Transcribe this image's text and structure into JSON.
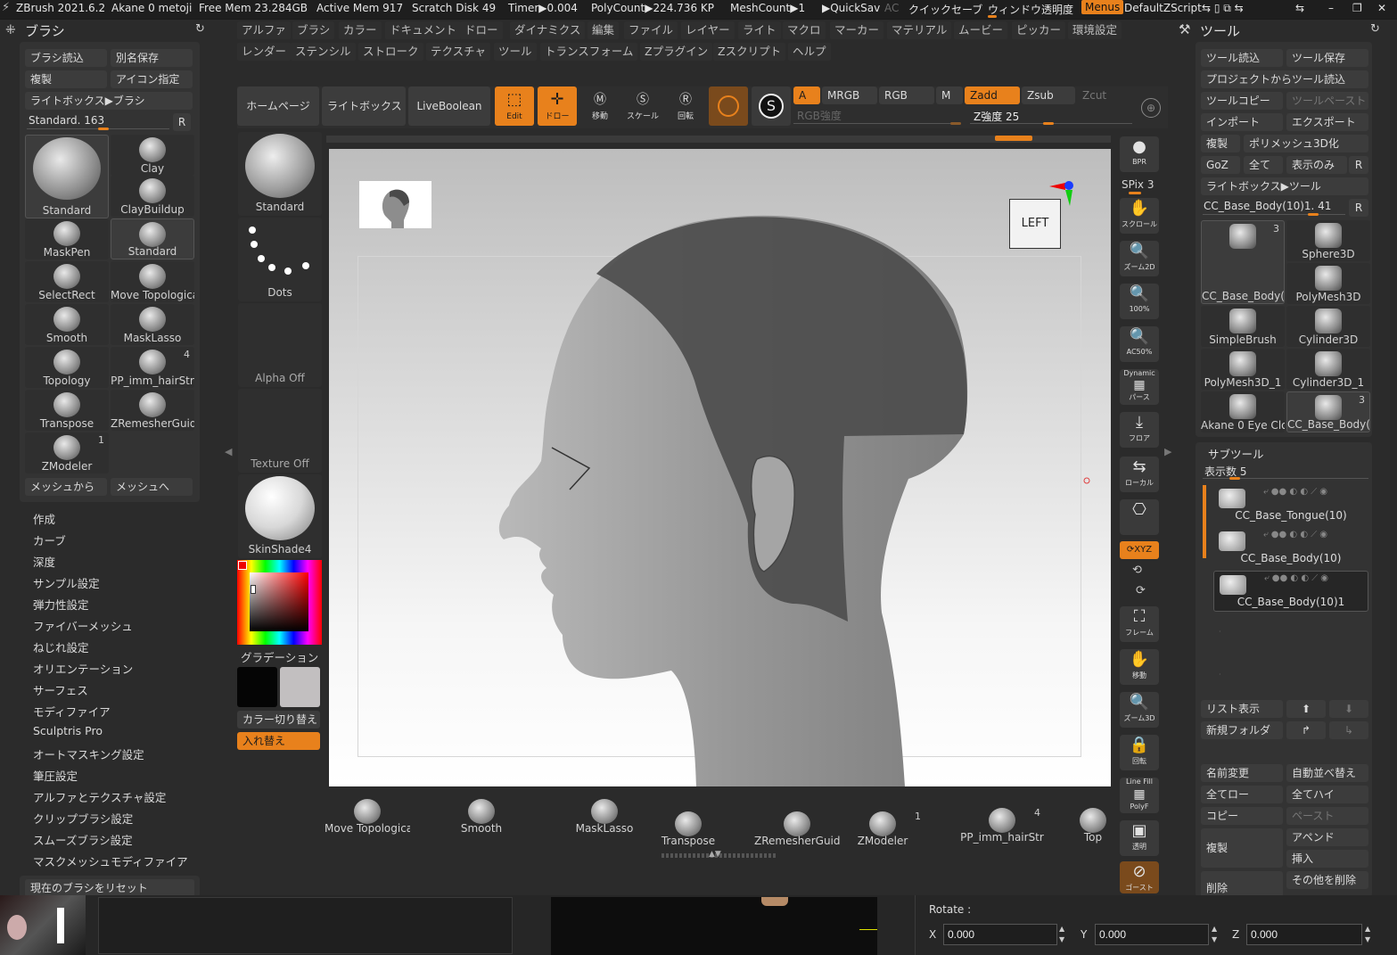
{
  "titlebar": {
    "app": "ZBrush 2021.6.2",
    "doc": "Akane 0 metoji",
    "free_mem": "Free Mem 23.284GB",
    "active_mem": "Active Mem 917",
    "scratch": "Scratch Disk 49",
    "timer": "Timer▶0.004",
    "polycount": "PolyCount▶224.736 KP",
    "meshcount": "MeshCount▶1",
    "quicksave": "▶QuickSav",
    "ac": "AC",
    "quicksave_jp": "クイックセーブ",
    "window_trans": "ウィンドウ透明度",
    "menus": "Menus",
    "defaultzscript": "DefaultZScript"
  },
  "menu_row1": [
    "アルファ",
    "ブラシ",
    "カラー",
    "ドキュメント",
    "ドロー",
    "ダイナミクス",
    "編集",
    "ファイル",
    "レイヤー",
    "ライト",
    "マクロ",
    "マーカー",
    "マテリアル",
    "ムービー",
    "ピッカー",
    "環境設定"
  ],
  "menu_row2": [
    "レンダー",
    "ステンシル",
    "ストローク",
    "テクスチャ",
    "ツール",
    "トランスフォーム",
    "Zプラグイン",
    "Zスクリプト",
    "ヘルプ"
  ],
  "left_panel": {
    "title": "ブラシ",
    "buttons": {
      "load": "ブラシ読込",
      "saveas": "別名保存",
      "clone": "複製",
      "icon": "アイコン指定",
      "lightbox": "ライトボックス▶ブラシ",
      "reset": "現在のブラシをリセット",
      "from_mesh": "メッシュから",
      "to_mesh": "メッシュへ"
    },
    "slider_label": "Standard. 163",
    "r": "R",
    "brushes": [
      {
        "name": "Standard",
        "count": ""
      },
      {
        "name": "Clay",
        "count": ""
      },
      {
        "name": "ClayBuildup",
        "count": ""
      },
      {
        "name": "MaskPen",
        "count": ""
      },
      {
        "name": "Standard",
        "count": ""
      },
      {
        "name": "SelectRect",
        "count": ""
      },
      {
        "name": "Move Topologica",
        "count": ""
      },
      {
        "name": "Smooth",
        "count": ""
      },
      {
        "name": "MaskLasso",
        "count": ""
      },
      {
        "name": "Topology",
        "count": ""
      },
      {
        "name": "PP_imm_hairStr",
        "count": "4"
      },
      {
        "name": "Transpose",
        "count": ""
      },
      {
        "name": "ZRemesherGuide",
        "count": ""
      },
      {
        "name": "ZModeler",
        "count": "1"
      }
    ],
    "sections": [
      "作成",
      "カーブ",
      "深度",
      "サンプル設定",
      "弾力性設定",
      "ファイバーメッシュ",
      "ねじれ設定",
      "オリエンテーション",
      "サーフェス",
      "モディファイア",
      "Sculptris Pro",
      "オートマスキング設定",
      "筆圧設定",
      "アルファとテクスチャ設定",
      "クリップブラシ設定",
      "スムーズブラシ設定",
      "マスクメッシュモディファイア"
    ]
  },
  "shelf": {
    "brush": "Standard",
    "stroke": "Dots",
    "alpha": "Alpha Off",
    "texture": "Texture Off",
    "material": "SkinShade4",
    "gradient": "グラデーション",
    "switch": "カラー切り替え",
    "swap": "入れ替え"
  },
  "toolbar": {
    "home": "ホームページ",
    "lightbox": "ライトボックス",
    "liveboolean": "LiveBoolean",
    "edit": "Edit",
    "draw": "ドロー",
    "move": "移動",
    "scale": "スケール",
    "rotate": "回転",
    "a": "A",
    "mrgb": "MRGB",
    "rgb": "RGB",
    "m": "M",
    "zadd": "Zadd",
    "zsub": "Zsub",
    "zcut": "Zcut",
    "rgb_intensity": "RGB強度",
    "z_intensity": "Z強度 25"
  },
  "viewport": {
    "view_label": "LEFT"
  },
  "right_toolbar": {
    "bpr": "BPR",
    "spix": "SPix 3",
    "scroll": "スクロール",
    "zoom2d": "ズーム2D",
    "p100": "100%",
    "ac50": "AC50%",
    "dynamic": "Dynamic",
    "perspective": "パース",
    "floor": "フロア",
    "local": "ローカル",
    "xyz": "XYZ",
    "frame": "フレーム",
    "move": "移動",
    "zoom3d": "ズーム3D",
    "rotate": "回転",
    "linefill": "Line Fill",
    "polyf": "PolyF",
    "transp": "透明",
    "ghost": "ゴースト"
  },
  "tool_panel": {
    "title": "ツール",
    "buttons": {
      "load": "ツール読込",
      "save": "ツール保存",
      "from_project": "プロジェクトからツール読込",
      "copy": "ツールコピー",
      "paste": "ツールペースト",
      "import": "インポート",
      "export": "エクスポート",
      "clone": "複製",
      "polymesh": "ポリメッシュ3D化",
      "goz": "GoZ",
      "all": "全て",
      "visible": "表示のみ",
      "r": "R",
      "lightbox": "ライトボックス▶ツール"
    },
    "slider_label": "CC_Base_Body(10)1. 41",
    "tools": [
      {
        "name": "CC_Base_Body(",
        "count": "3"
      },
      {
        "name": "Sphere3D",
        "count": ""
      },
      {
        "name": "PolyMesh3D",
        "count": ""
      },
      {
        "name": "SimpleBrush",
        "count": ""
      },
      {
        "name": "Cylinder3D",
        "count": ""
      },
      {
        "name": "PolyMesh3D_1",
        "count": ""
      },
      {
        "name": "Cylinder3D_1",
        "count": ""
      },
      {
        "name": "Akane 0 Eye Clos",
        "count": ""
      },
      {
        "name": "CC_Base_Body(",
        "count": "3"
      }
    ]
  },
  "subtool": {
    "title": "サブツール",
    "display_count": "表示数 5",
    "items": [
      "CC_Base_Tongue(10)",
      "CC_Base_Body(10)",
      "CC_Base_Body(10)1"
    ],
    "buttons": {
      "list": "リスト表示",
      "new_folder": "新規フォルダ",
      "rename": "名前変更",
      "autosort": "自動並べ替え",
      "all_low": "全てロー",
      "all_high": "全てハイ",
      "copy": "コピー",
      "paste": "ペースト",
      "duplicate": "複製",
      "append": "アペンド",
      "insert": "挿入",
      "delete": "削除",
      "delete_other": "その他を削除"
    }
  },
  "bottom_shelf": [
    {
      "name": "Move Topologica",
      "count": ""
    },
    {
      "name": "Smooth",
      "count": ""
    },
    {
      "name": "MaskLasso",
      "count": ""
    },
    {
      "name": "Transpose",
      "count": ""
    },
    {
      "name": "ZRemesherGuide",
      "count": ""
    },
    {
      "name": "ZModeler",
      "count": "1"
    },
    {
      "name": "PP_imm_hairStr",
      "count": "4"
    },
    {
      "name": "Top",
      "count": ""
    }
  ],
  "rotate_panel": {
    "label": "Rotate :",
    "x_label": "X",
    "y_label": "Y",
    "z_label": "Z",
    "x": "0.000",
    "y": "0.000",
    "z": "0.000"
  },
  "colors": {
    "accent": "#e8811c",
    "panel": "#333333",
    "background": "#2b2b2b"
  }
}
